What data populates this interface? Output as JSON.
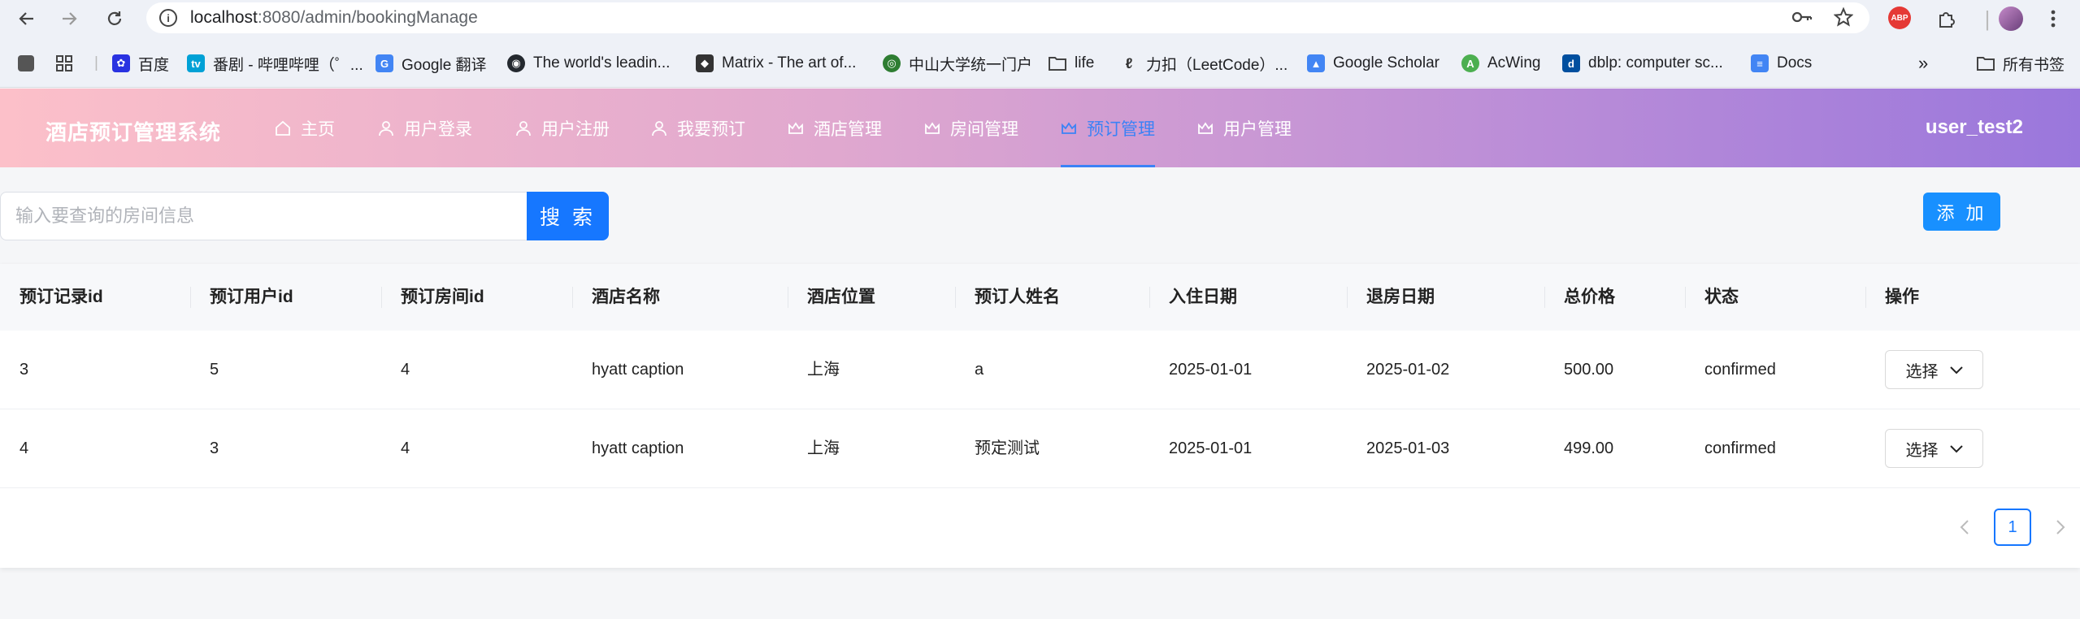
{
  "browser": {
    "url_host": "localhost",
    "url_path": ":8080/admin/bookingManage",
    "bookmarks": [
      {
        "label": "百度",
        "icon": "baidu-paw-icon",
        "color": "#2932e1"
      },
      {
        "label": "番剧 - 哔哩哔哩（゜...",
        "icon": "bilibili-icon",
        "color": "#00a1d6"
      },
      {
        "label": "Google 翻译",
        "icon": "google-translate-icon",
        "color": "#4285f4"
      },
      {
        "label": "The world's leadin...",
        "icon": "github-icon",
        "color": "#24292f"
      },
      {
        "label": "Matrix - The art of...",
        "icon": "matrix-icon",
        "color": "#333333"
      },
      {
        "label": "中山大学统一门户",
        "icon": "sysu-icon",
        "color": "#2e7d32"
      },
      {
        "label": "life",
        "icon": "folder-icon",
        "color": "#444444"
      },
      {
        "label": "力扣（LeetCode）...",
        "icon": "leetcode-icon",
        "color": "#333333"
      },
      {
        "label": "Google Scholar",
        "icon": "google-scholar-icon",
        "color": "#4285f4"
      },
      {
        "label": "AcWing",
        "icon": "acwing-icon",
        "color": "#4caf50"
      },
      {
        "label": "dblp: computer sc...",
        "icon": "dblp-icon",
        "color": "#004f9f"
      },
      {
        "label": "Docs",
        "icon": "docs-icon",
        "color": "#4285f4"
      }
    ],
    "all_bookmarks": "所有书签"
  },
  "header": {
    "brand": "酒店预订管理系统",
    "menu": [
      {
        "label": "主页",
        "icon": "home-icon"
      },
      {
        "label": "用户登录",
        "icon": "user-icon"
      },
      {
        "label": "用户注册",
        "icon": "user-icon"
      },
      {
        "label": "我要预订",
        "icon": "user-icon"
      },
      {
        "label": "酒店管理",
        "icon": "crown-icon"
      },
      {
        "label": "房间管理",
        "icon": "crown-icon"
      },
      {
        "label": "预订管理",
        "icon": "crown-icon",
        "active": true
      },
      {
        "label": "用户管理",
        "icon": "crown-icon"
      }
    ],
    "username": "user_test2",
    "active_color": "#3b82f6"
  },
  "search": {
    "placeholder": "输入要查询的房间信息",
    "button": "搜 索"
  },
  "add_button": "添 加",
  "table": {
    "columns": [
      "预订记录id",
      "预订用户id",
      "预订房间id",
      "酒店名称",
      "酒店位置",
      "预订人姓名",
      "入住日期",
      "退房日期",
      "总价格",
      "状态",
      "操作"
    ],
    "rows": [
      [
        "3",
        "5",
        "4",
        "hyatt caption",
        "上海",
        "a",
        "2025-01-01",
        "2025-01-02",
        "500.00",
        "confirmed"
      ],
      [
        "4",
        "3",
        "4",
        "hyatt caption",
        "上海",
        "预定测试",
        "2025-01-01",
        "2025-01-03",
        "499.00",
        "confirmed"
      ]
    ],
    "action_label": "选择"
  },
  "pagination": {
    "current": "1"
  }
}
